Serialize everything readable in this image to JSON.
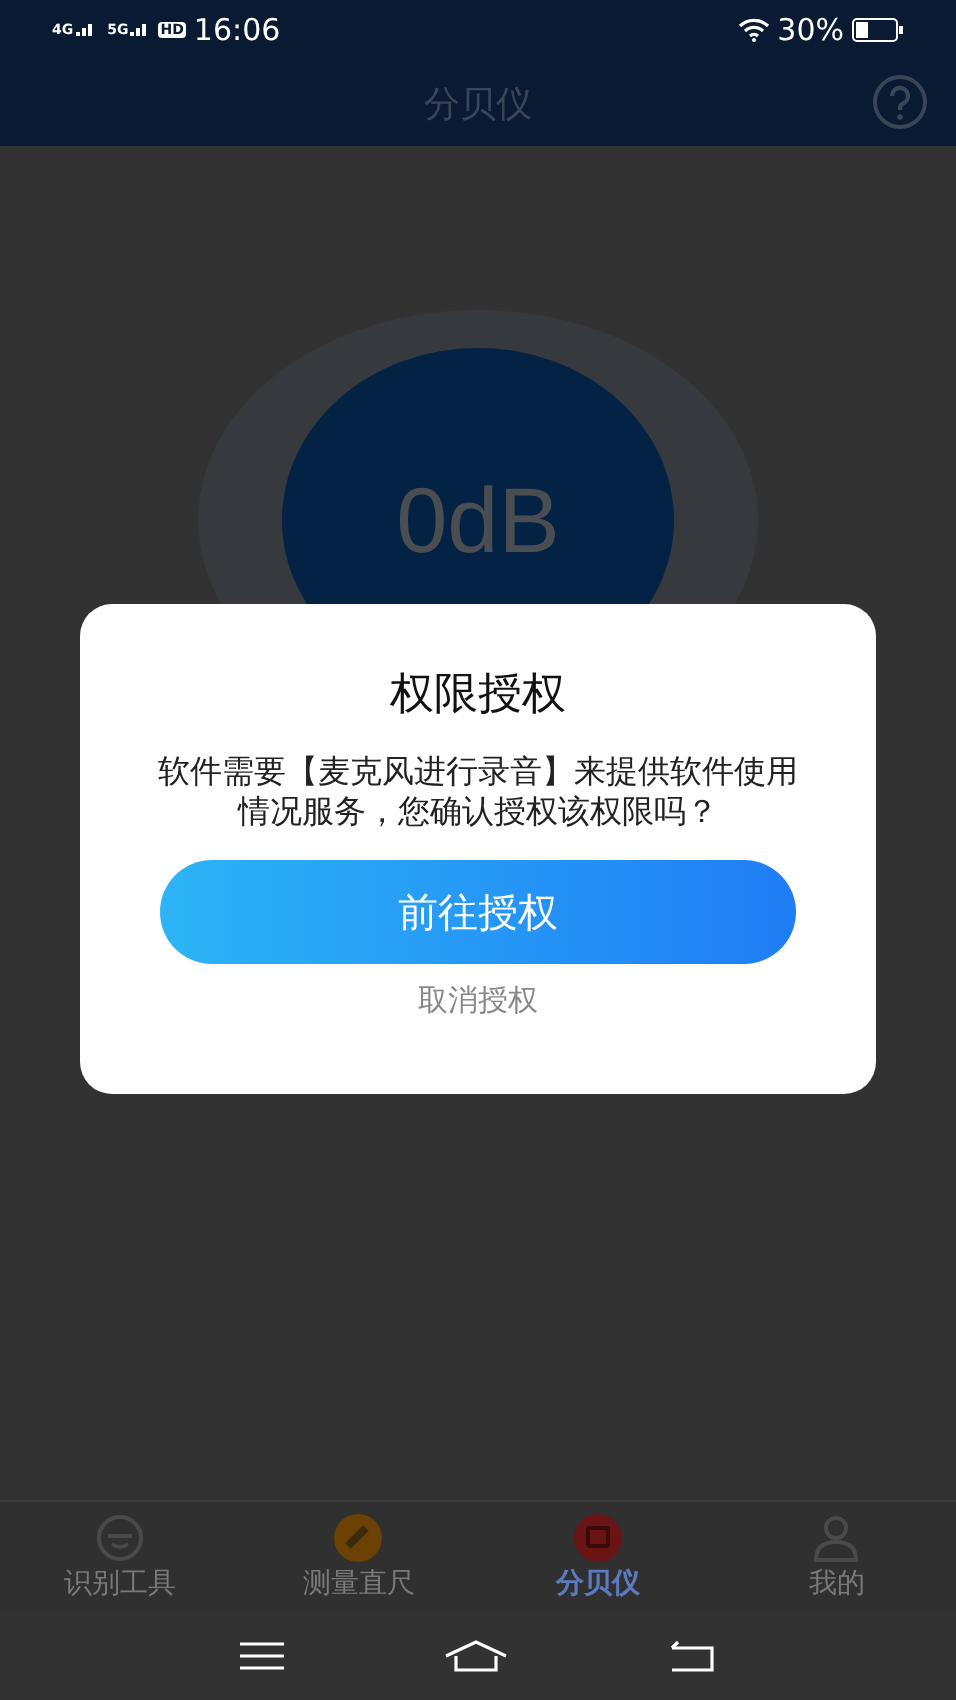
{
  "status_bar": {
    "networks": [
      "4G",
      "5G"
    ],
    "hd": "HD",
    "time": "16:06",
    "battery": "30%"
  },
  "header": {
    "title": "分贝仪"
  },
  "meter": {
    "reading": "0dB"
  },
  "dialog": {
    "title": "权限授权",
    "message": "软件需要【麦克风进行录音】来提供软件使用情况服务，您确认授权该权限吗？",
    "confirm": "前往授权",
    "cancel": "取消授权"
  },
  "tabs": [
    {
      "label": "识别工具",
      "kind": "face",
      "selected": false
    },
    {
      "label": "测量直尺",
      "kind": "ruler",
      "selected": false
    },
    {
      "label": "分贝仪",
      "kind": "meter",
      "selected": true
    },
    {
      "label": "我的",
      "kind": "person",
      "selected": false
    }
  ]
}
